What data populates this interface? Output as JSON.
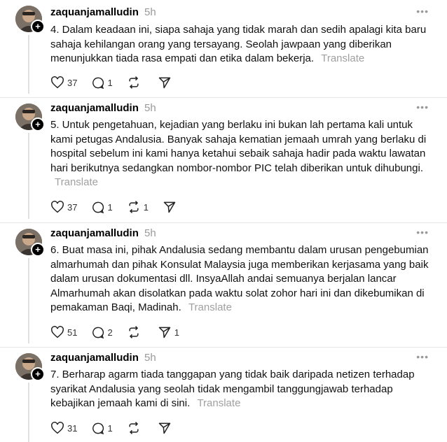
{
  "posts": [
    {
      "username": "zaquanjamalludin",
      "time": "5h",
      "text": "4. Dalam keadaan ini, siapa sahaja yang tidak marah dan sedih apalagi kita baru sahaja kehilangan orang yang tersayang. Seolah jawpaan yang diberikan menunjukkan tiada rasa empati dan etika dalam bekerja.",
      "translate": "Translate",
      "likes": "37",
      "replies": "1",
      "reposts": "",
      "shares": ""
    },
    {
      "username": "zaquanjamalludin",
      "time": "5h",
      "text": "5. Untuk pengetahuan, kejadian yang berlaku ini bukan lah pertama kali untuk kami petugas Andalusia. Banyak sahaja kematian jemaah umrah yang berlaku di hospital sebelum ini kami hanya ketahui sebaik sahaja hadir pada waktu lawatan hari berikutnya sedangkan nombor-nombor PIC telah diberikan untuk dihubungi.",
      "translate": "Translate",
      "likes": "37",
      "replies": "1",
      "reposts": "1",
      "shares": ""
    },
    {
      "username": "zaquanjamalludin",
      "time": "5h",
      "text": "6. Buat masa ini, pihak Andalusia sedang membantu dalam urusan pengebumian almarhumah dan pihak Konsulat Malaysia juga memberikan kerjasama yang baik dalam urusan dokumentasi dll. InsyaAllah andai semuanya berjalan lancar Almarhumah akan disolatkan pada waktu solat zohor hari ini dan dikebumikan di pemakaman Baqi, Madinah.",
      "translate": "Translate",
      "likes": "51",
      "replies": "2",
      "reposts": "",
      "shares": "1"
    },
    {
      "username": "zaquanjamalludin",
      "time": "5h",
      "text": "7. Berharap agarm tiada tanggapan yang tidak baik daripada netizen terhadap syarikat Andalusia yang seolah tidak mengambil tanggungjawab terhadap kebajikan jemaah kami di sini.",
      "translate": "Translate",
      "likes": "31",
      "replies": "1",
      "reposts": "",
      "shares": ""
    }
  ],
  "icons": {
    "like": "heart-icon",
    "reply": "comment-icon",
    "repost": "repost-icon",
    "share": "send-icon",
    "more": "more-icon",
    "follow": "plus-icon"
  },
  "colors": {
    "muted": "#999999",
    "translate": "#a0a0a0",
    "divider": "#e6e6e6"
  }
}
